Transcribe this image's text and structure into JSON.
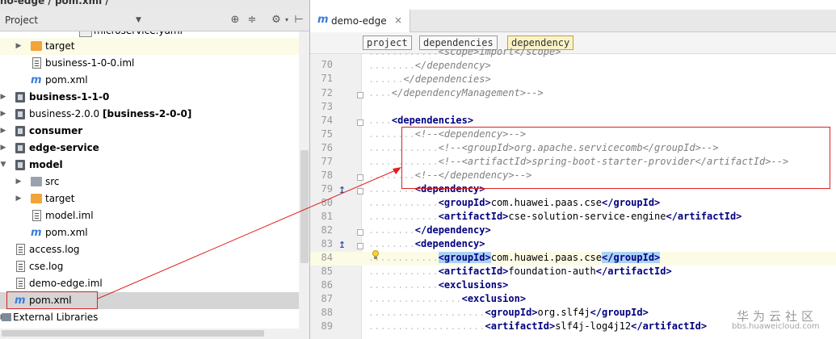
{
  "breadcrumb_top": "no-edge / pom.xml /",
  "project_panel": {
    "title": "Project",
    "dropdown_icon": "chevron-down-icon",
    "tool_icons": [
      "locate-icon",
      "collapse-icon",
      "gear-icon",
      "hide-icon"
    ]
  },
  "tree": [
    {
      "label": "microservice.yaml",
      "icon": "yaml-icon",
      "bold": false
    },
    {
      "label": "target",
      "icon": "folder-orange-icon",
      "bold": false
    },
    {
      "label": "business-1-0-0.iml",
      "icon": "iml-file-icon",
      "bold": false
    },
    {
      "label": "pom.xml",
      "icon": "maven-icon",
      "bold": false
    },
    {
      "label": "business-1-1-0",
      "icon": "module-icon",
      "bold": true
    },
    {
      "label": "business-2.0.0",
      "suffix": "[business-2-0-0]",
      "icon": "module-icon",
      "bold": false
    },
    {
      "label": "consumer",
      "icon": "module-icon",
      "bold": true
    },
    {
      "label": "edge-service",
      "icon": "module-icon",
      "bold": true
    },
    {
      "label": "model",
      "icon": "module-icon",
      "bold": true
    },
    {
      "label": "src",
      "icon": "folder-icon",
      "bold": false
    },
    {
      "label": "target",
      "icon": "folder-orange-icon",
      "bold": false
    },
    {
      "label": "model.iml",
      "icon": "iml-file-icon",
      "bold": false
    },
    {
      "label": "pom.xml",
      "icon": "maven-icon",
      "bold": false
    },
    {
      "label": "access.log",
      "icon": "text-file-icon",
      "bold": false
    },
    {
      "label": "cse.log",
      "icon": "text-file-icon",
      "bold": false
    },
    {
      "label": "demo-edge.iml",
      "icon": "iml-file-icon",
      "bold": false
    },
    {
      "label": "pom.xml",
      "icon": "maven-icon",
      "bold": false
    },
    {
      "label": "External Libraries",
      "icon": "library-icon",
      "bold": false
    }
  ],
  "editor": {
    "tab_label": "demo-edge",
    "tab_close": "×",
    "crumbs": [
      "project",
      "dependencies",
      "dependency"
    ],
    "line_numbers": [
      "70",
      "71",
      "72",
      "73",
      "74",
      "75",
      "76",
      "77",
      "78",
      "79",
      "80",
      "81",
      "82",
      "83",
      "84",
      "85",
      "86",
      "87",
      "88",
      "89"
    ],
    "lines": {
      "l69": "<scope>import</scope>",
      "l70": "</dependency>",
      "l71": "</dependencies>",
      "l72": "</dependencyManagement>-->",
      "l74": "<dependencies>",
      "l75": "<!--<dependency>-->",
      "l76": "<!--<groupId>org.apache.servicecomb</groupId>-->",
      "l77": "<!--<artifactId>spring-boot-starter-provider</artifactId>-->",
      "l78": "<!--</dependency>-->",
      "l79": "<dependency>",
      "l80_open": "<groupId>",
      "l80_val": "com.huawei.paas.cse",
      "l80_close": "</groupId>",
      "l81_open": "<artifactId>",
      "l81_val": "cse-solution-service-engine",
      "l81_close": "</artifactId>",
      "l82": "</dependency>",
      "l83": "<dependency>",
      "l84_open": "<groupId>",
      "l84_val": "com.huawei.paas.cse",
      "l84_close": "</groupId>",
      "l85_open": "<artifactId>",
      "l85_val": "foundation-auth",
      "l85_close": "</artifactId>",
      "l86": "<exclusions>",
      "l87": "<exclusion>",
      "l88_open": "<groupId>",
      "l88_val": "org.slf4j",
      "l88_close": "</groupId>",
      "l89_open": "<artifactId>",
      "l89_val": "slf4j-log4j12",
      "l89_close": "</artifactId>"
    }
  },
  "watermark": {
    "cn": "华为云社区",
    "url": "bbs.huaweicloud.com"
  },
  "colors": {
    "annotation_red": "#e02020",
    "tag_blue": "#000080",
    "comment_gray": "#808080",
    "current_line": "#fcfbe6"
  }
}
